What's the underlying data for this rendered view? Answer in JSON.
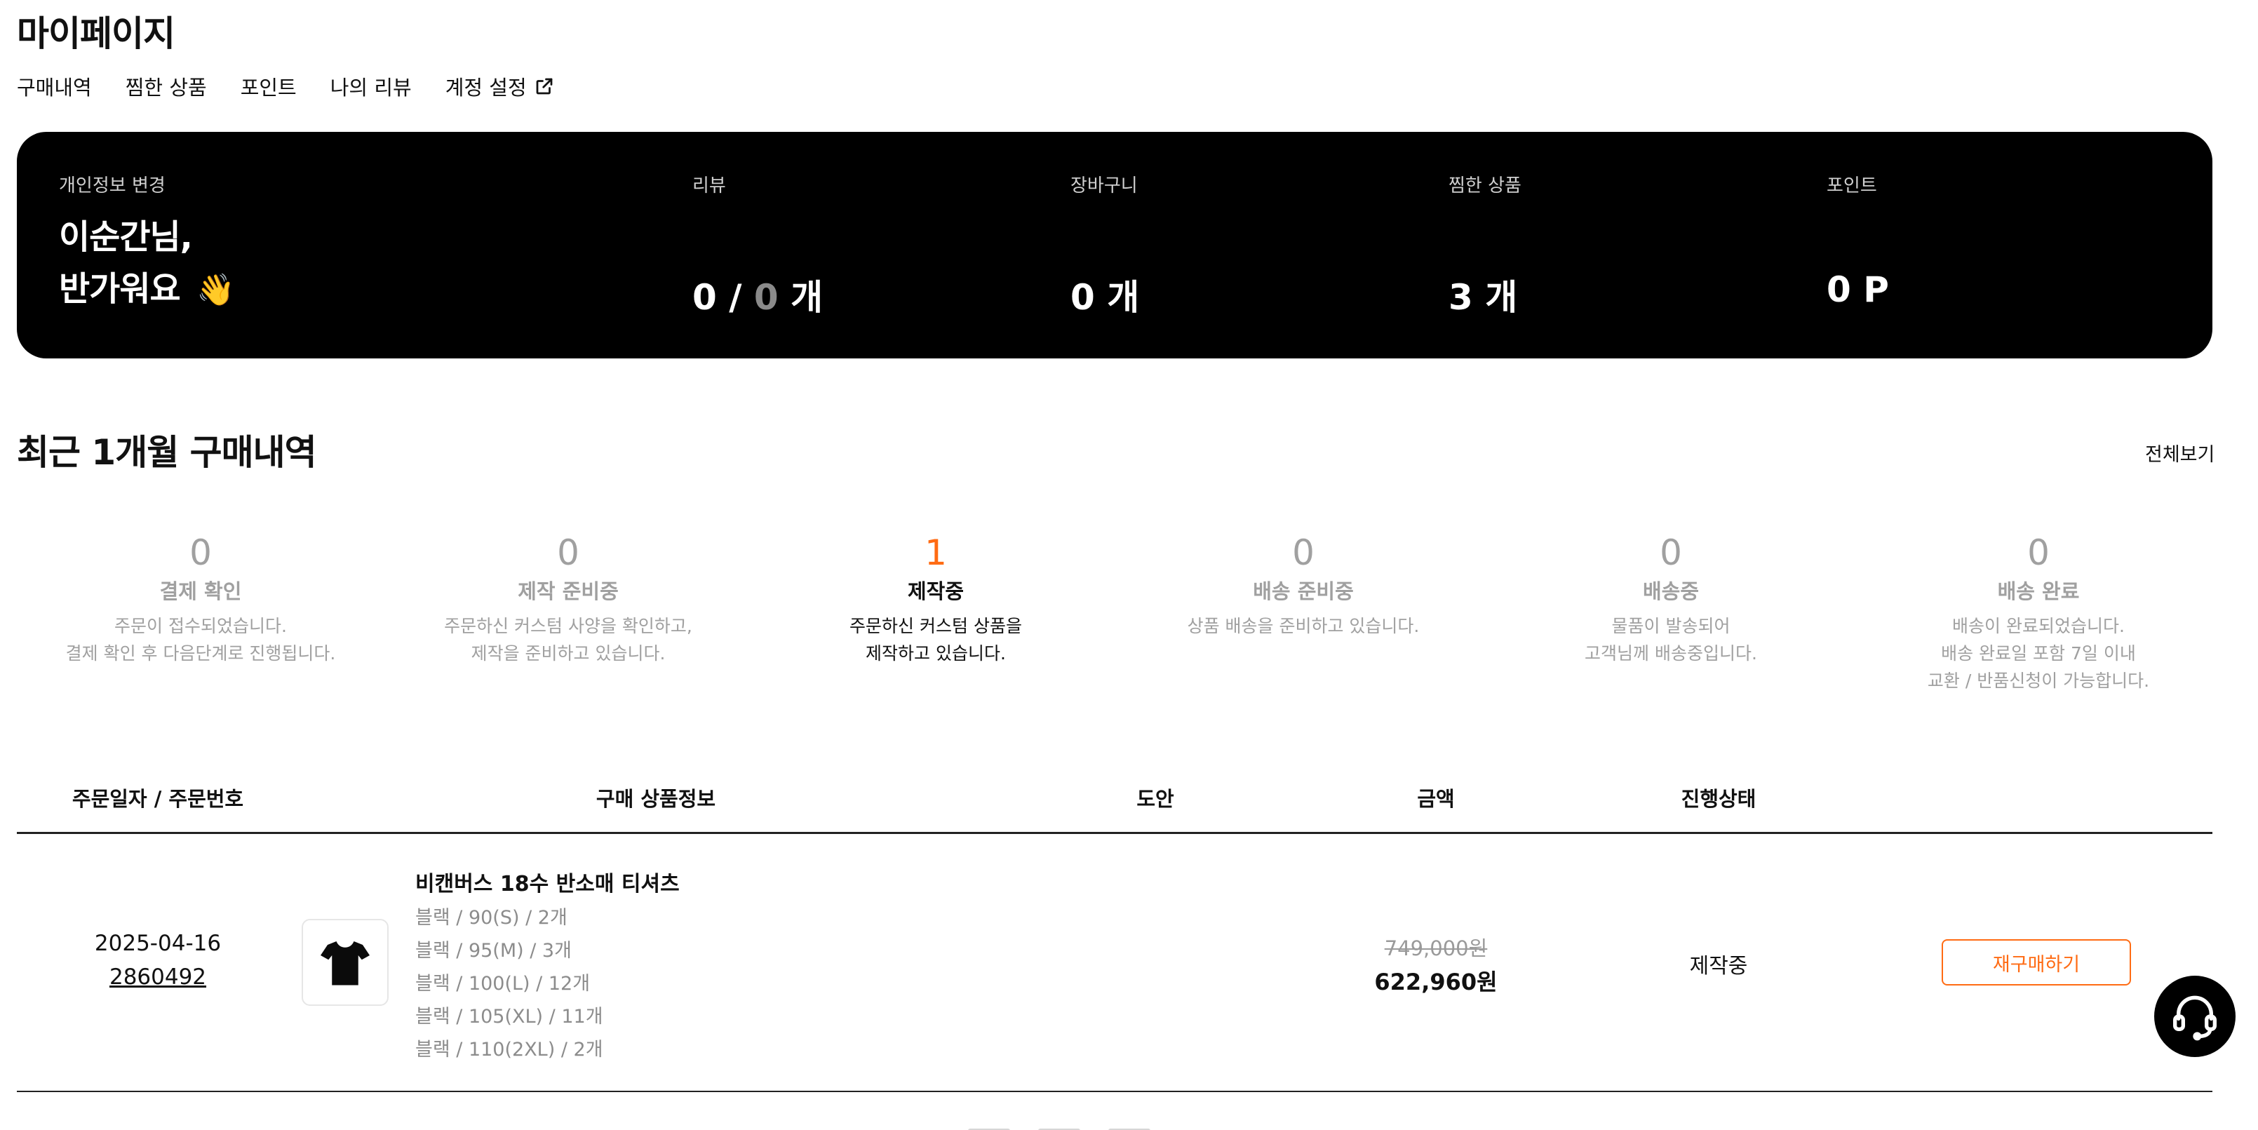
{
  "page": {
    "title": "마이페이지"
  },
  "tabs": [
    {
      "label": "구매내역"
    },
    {
      "label": "찜한 상품"
    },
    {
      "label": "포인트"
    },
    {
      "label": "나의 리뷰"
    },
    {
      "label": "계정 설정",
      "icon": "external-link-icon"
    }
  ],
  "summary": {
    "profile": {
      "label": "개인정보 변경",
      "greeting_line1": "이순간님,",
      "greeting_line2": "반가워요",
      "emoji": "👋"
    },
    "review": {
      "label": "리뷰",
      "written": "0",
      "separator": "/",
      "available": "0",
      "unit": "개"
    },
    "cart": {
      "label": "장바구니",
      "value": "0 개"
    },
    "wishlist": {
      "label": "찜한 상품",
      "value": "3 개"
    },
    "points": {
      "label": "포인트",
      "value": "0 P"
    }
  },
  "recent": {
    "title": "최근 1개월 구매내역",
    "view_all": "전체보기",
    "steps": [
      {
        "count": "0",
        "name": "결제 확인",
        "desc": [
          "주문이 접수되었습니다.",
          "결제 확인 후 다음단계로 진행됩니다."
        ]
      },
      {
        "count": "0",
        "name": "제작 준비중",
        "desc": [
          "주문하신 커스텀 사양을 확인하고,",
          "제작을 준비하고 있습니다."
        ]
      },
      {
        "count": "1",
        "name": "제작중",
        "desc": [
          "주문하신 커스텀 상품을",
          "제작하고 있습니다."
        ],
        "active": true
      },
      {
        "count": "0",
        "name": "배송 준비중",
        "desc": [
          "상품 배송을 준비하고 있습니다."
        ]
      },
      {
        "count": "0",
        "name": "배송중",
        "desc": [
          "물품이 발송되어",
          "고객님께 배송중입니다."
        ]
      },
      {
        "count": "0",
        "name": "배송 완료",
        "desc": [
          "배송이 완료되었습니다.",
          "배송 완료일 포함 7일 이내",
          "교환 / 반품신청이 가능합니다."
        ]
      }
    ]
  },
  "table": {
    "headers": {
      "order": "주문일자 / 주문번호",
      "product": "구매 상품정보",
      "design": "도안",
      "amount": "금액",
      "status": "진행상태"
    },
    "rows": [
      {
        "date": "2025-04-16",
        "order_no": "2860492",
        "product_name": "비캔버스 18수 반소매 티셔츠",
        "options": [
          "블랙 / 90(S) / 2개",
          "블랙 / 95(M) / 3개",
          "블랙 / 100(L) / 12개",
          "블랙 / 105(XL) / 11개",
          "블랙 / 110(2XL) / 2개"
        ],
        "price_original": "749,000원",
        "price_final": "622,960원",
        "status": "제작중",
        "reorder_label": "재구매하기"
      }
    ]
  },
  "colors": {
    "accent": "#ff6b13",
    "card": "#000000",
    "muted": "#a0a0a0"
  },
  "floating": {
    "icon": "headset-icon"
  }
}
